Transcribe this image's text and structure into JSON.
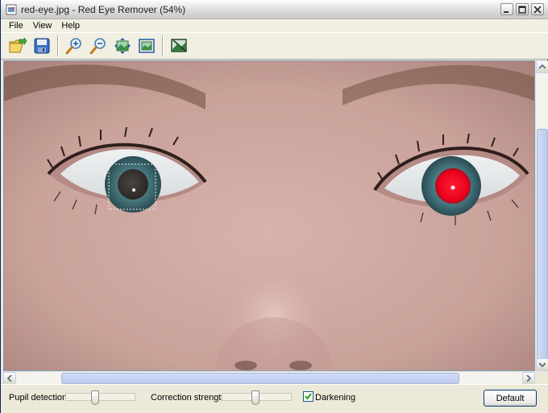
{
  "window": {
    "title": "red-eye.jpg - Red Eye Remover (54%)",
    "icon": "app-photo-icon",
    "controls": [
      "minimize-icon",
      "maximize-icon",
      "close-icon"
    ]
  },
  "menu": {
    "items": [
      "File",
      "View",
      "Help"
    ]
  },
  "toolbar": {
    "buttons": [
      {
        "icon": "open-folder-icon",
        "tooltip": ""
      },
      {
        "icon": "save-icon",
        "tooltip": ""
      },
      {
        "icon": "zoom-in-icon",
        "tooltip": ""
      },
      {
        "icon": "zoom-out-icon",
        "tooltip": ""
      },
      {
        "icon": "fit-to-window-icon",
        "tooltip": ""
      },
      {
        "icon": "actual-size-icon",
        "tooltip": ""
      },
      {
        "icon": "image-preview-icon",
        "tooltip": ""
      }
    ]
  },
  "image": {
    "zoom_percent": 54,
    "selection_around_left_pupil": true,
    "left_pupil_state": "corrected",
    "right_pupil_state": "red-eye"
  },
  "controls": {
    "pupil_detection_label": "Pupil detection",
    "pupil_detection_value": 0.42,
    "correction_strength_label": "Correction strength",
    "correction_strength_value": 0.48,
    "darkening_label": "Darkening",
    "darkening_checked": true,
    "default_button_label": "Default"
  },
  "colors": {
    "red_eye": "#e8001a",
    "titlebar": "#dcdcdc",
    "panel": "#ece9d8"
  }
}
